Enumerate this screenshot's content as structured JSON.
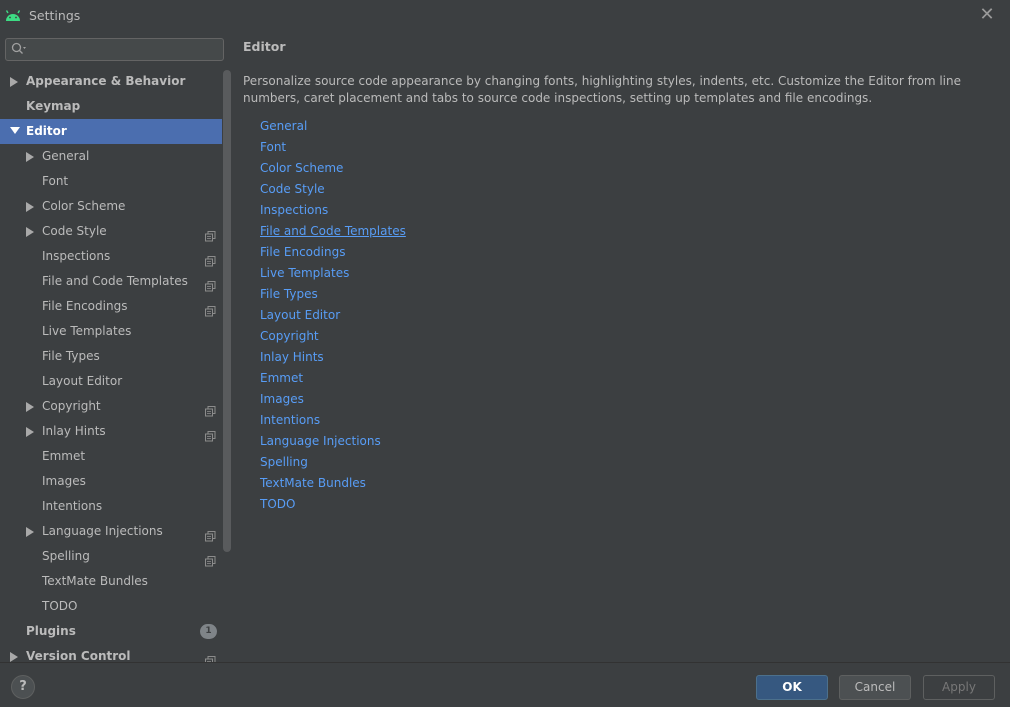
{
  "window": {
    "title": "Settings"
  },
  "colors": {
    "accent": "#4b6eaf",
    "link": "#589df6",
    "ok_button": "#365880",
    "background": "#3c3f41"
  },
  "search": {
    "placeholder": ""
  },
  "sidebar": {
    "items": [
      {
        "label": "Appearance & Behavior",
        "level": 0,
        "arrow": "right",
        "selected": false,
        "copy_icon": false
      },
      {
        "label": "Keymap",
        "level": 0,
        "arrow": "",
        "selected": false,
        "copy_icon": false
      },
      {
        "label": "Editor",
        "level": 0,
        "arrow": "down",
        "selected": true,
        "copy_icon": false
      },
      {
        "label": "General",
        "level": 1,
        "arrow": "right",
        "selected": false,
        "copy_icon": false
      },
      {
        "label": "Font",
        "level": 1,
        "arrow": "",
        "selected": false,
        "copy_icon": false
      },
      {
        "label": "Color Scheme",
        "level": 1,
        "arrow": "right",
        "selected": false,
        "copy_icon": false
      },
      {
        "label": "Code Style",
        "level": 1,
        "arrow": "right",
        "selected": false,
        "copy_icon": true
      },
      {
        "label": "Inspections",
        "level": 1,
        "arrow": "",
        "selected": false,
        "copy_icon": true
      },
      {
        "label": "File and Code Templates",
        "level": 1,
        "arrow": "",
        "selected": false,
        "copy_icon": true
      },
      {
        "label": "File Encodings",
        "level": 1,
        "arrow": "",
        "selected": false,
        "copy_icon": true
      },
      {
        "label": "Live Templates",
        "level": 1,
        "arrow": "",
        "selected": false,
        "copy_icon": false
      },
      {
        "label": "File Types",
        "level": 1,
        "arrow": "",
        "selected": false,
        "copy_icon": false
      },
      {
        "label": "Layout Editor",
        "level": 1,
        "arrow": "",
        "selected": false,
        "copy_icon": false
      },
      {
        "label": "Copyright",
        "level": 1,
        "arrow": "right",
        "selected": false,
        "copy_icon": true
      },
      {
        "label": "Inlay Hints",
        "level": 1,
        "arrow": "right",
        "selected": false,
        "copy_icon": true
      },
      {
        "label": "Emmet",
        "level": 1,
        "arrow": "",
        "selected": false,
        "copy_icon": false
      },
      {
        "label": "Images",
        "level": 1,
        "arrow": "",
        "selected": false,
        "copy_icon": false
      },
      {
        "label": "Intentions",
        "level": 1,
        "arrow": "",
        "selected": false,
        "copy_icon": false
      },
      {
        "label": "Language Injections",
        "level": 1,
        "arrow": "right",
        "selected": false,
        "copy_icon": true
      },
      {
        "label": "Spelling",
        "level": 1,
        "arrow": "",
        "selected": false,
        "copy_icon": true
      },
      {
        "label": "TextMate Bundles",
        "level": 1,
        "arrow": "",
        "selected": false,
        "copy_icon": false
      },
      {
        "label": "TODO",
        "level": 1,
        "arrow": "",
        "selected": false,
        "copy_icon": false
      },
      {
        "label": "Plugins",
        "level": 0,
        "arrow": "",
        "selected": false,
        "copy_icon": false,
        "badge": "1"
      },
      {
        "label": "Version Control",
        "level": 0,
        "arrow": "right",
        "selected": false,
        "copy_icon": true
      }
    ]
  },
  "main": {
    "title": "Editor",
    "description": "Personalize source code appearance by changing fonts, highlighting styles, indents, etc. Customize the Editor from line numbers, caret placement and tabs to source code inspections, setting up templates and file encodings.",
    "links": [
      {
        "label": "General",
        "hovered": false
      },
      {
        "label": "Font",
        "hovered": false
      },
      {
        "label": "Color Scheme",
        "hovered": false
      },
      {
        "label": "Code Style",
        "hovered": false
      },
      {
        "label": "Inspections",
        "hovered": false
      },
      {
        "label": "File and Code Templates",
        "hovered": true
      },
      {
        "label": "File Encodings",
        "hovered": false
      },
      {
        "label": "Live Templates",
        "hovered": false
      },
      {
        "label": "File Types",
        "hovered": false
      },
      {
        "label": "Layout Editor",
        "hovered": false
      },
      {
        "label": "Copyright",
        "hovered": false
      },
      {
        "label": "Inlay Hints",
        "hovered": false
      },
      {
        "label": "Emmet",
        "hovered": false
      },
      {
        "label": "Images",
        "hovered": false
      },
      {
        "label": "Intentions",
        "hovered": false
      },
      {
        "label": "Language Injections",
        "hovered": false
      },
      {
        "label": "Spelling",
        "hovered": false
      },
      {
        "label": "TextMate Bundles",
        "hovered": false
      },
      {
        "label": "TODO",
        "hovered": false
      }
    ]
  },
  "footer": {
    "help_label": "?",
    "ok_label": "OK",
    "cancel_label": "Cancel",
    "apply_label": "Apply"
  }
}
